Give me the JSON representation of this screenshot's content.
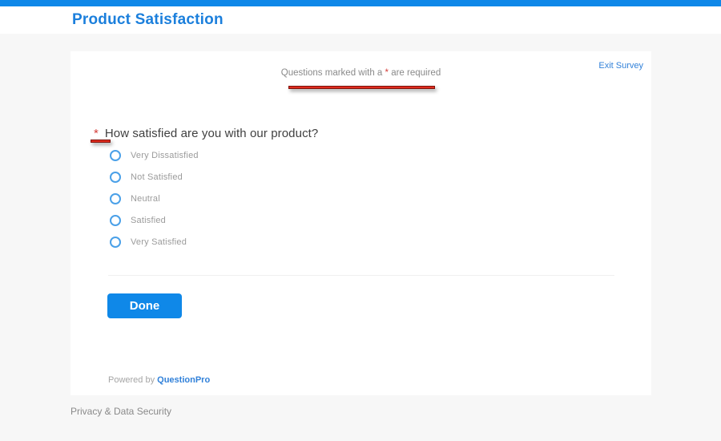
{
  "header": {
    "title": "Product Satisfaction"
  },
  "survey": {
    "exit_link_label": "Exit Survey",
    "required_note": {
      "prefix": "Questions marked with a ",
      "asterisk": "*",
      "suffix": " are required"
    },
    "question": {
      "asterisk": "*",
      "text": "How satisfied are you with our product?"
    },
    "options": [
      {
        "label": "Very Dissatisfied"
      },
      {
        "label": "Not Satisfied"
      },
      {
        "label": "Neutral"
      },
      {
        "label": "Satisfied"
      },
      {
        "label": "Very Satisfied"
      }
    ],
    "done_label": "Done",
    "powered_by": {
      "prefix": "Powered by ",
      "brand": "QuestionPro"
    }
  },
  "footer": {
    "privacy_label": "Privacy & Data Security"
  },
  "colors": {
    "accent_blue": "#0f88e8",
    "title_blue": "#1b7fdc",
    "link_blue": "#3181d9",
    "radio_blue": "#4aa0e8",
    "label_gray": "#9b9b9b",
    "annotation_red": "#df2b1e",
    "annotation_border": "#7f130b",
    "page_bg": "#f7f7f7"
  }
}
